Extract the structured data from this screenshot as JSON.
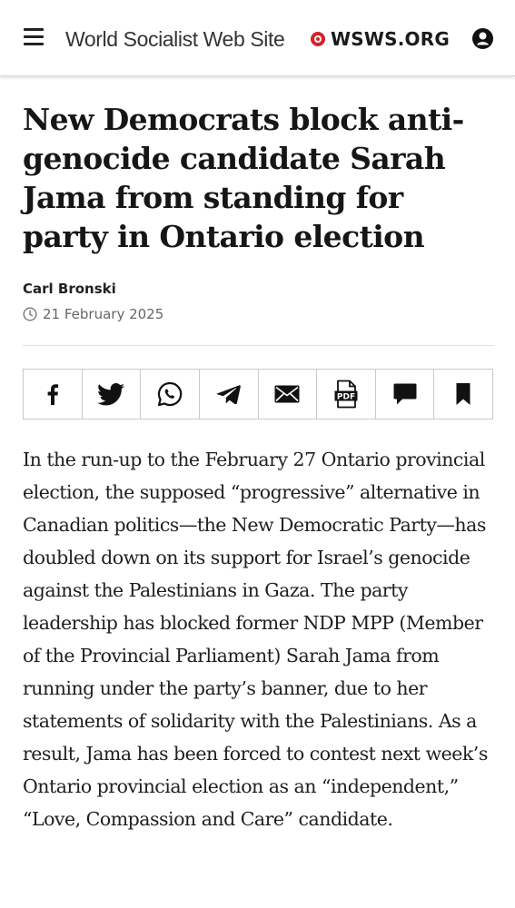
{
  "header": {
    "menu_icon": "hamburger-menu-icon",
    "site_name": "World Socialist Web Site",
    "brand": "WSWS.ORG",
    "account_icon": "user-account-icon",
    "brand_color": "#d6212b"
  },
  "article": {
    "title": "New Democrats block anti-genocide candidate Sarah Jama from standing for party in Ontario election",
    "author": "Carl Bronski",
    "date": "21 February 2025",
    "date_icon": "clock-icon",
    "body": "In the run-up to the February 27 Ontario provincial election, the supposed “progressive” alternative in Canadian politics—the New Democratic Party—has doubled down on its support for Israel’s genocide against the Palestinians in Gaza. The party leadership has blocked former NDP MPP (Member of the Provincial Parliament) Sarah Jama from running under the party’s banner, due to her statements of solidarity with the Palestinians. As a result, Jama has been forced to contest next week’s Ontario provincial election as an “independent,” “Love, Compassion and Care” candidate."
  },
  "share_bar": {
    "icons": [
      "facebook-icon",
      "twitter-icon",
      "whatsapp-icon",
      "telegram-icon",
      "email-icon",
      "pdf-icon",
      "comment-icon",
      "bookmark-icon"
    ],
    "pdf_label": "PDF"
  }
}
